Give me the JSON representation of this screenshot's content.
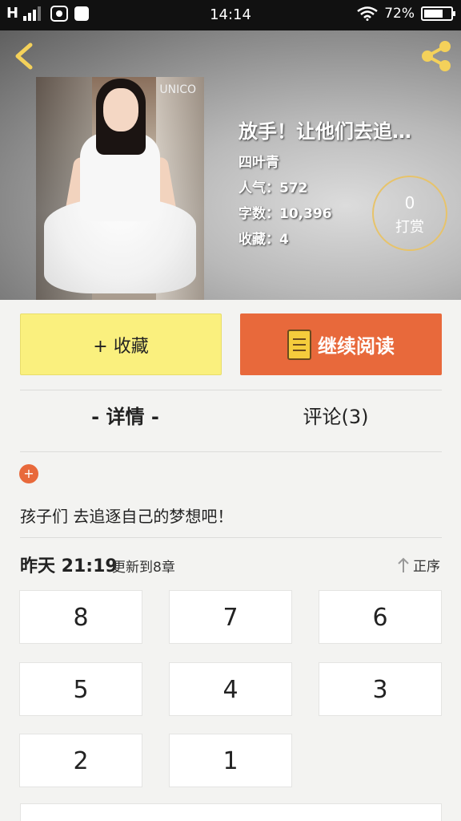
{
  "status_bar": {
    "network": "H",
    "time": "14:14",
    "battery_text": "72%",
    "battery_level": 0.72
  },
  "header": {
    "back_icon": "chevron-left-icon",
    "share_icon": "share-icon",
    "cover_sign_text": "UNICO",
    "title": "放手！让他们去追…",
    "author": "四叶青",
    "popularity": "人气：572",
    "word_count": "字数：10,396",
    "favorites": "收藏：4",
    "tip": {
      "count": "0",
      "label": "打赏"
    }
  },
  "actions": {
    "collect_label": "+ 收藏",
    "read_label": "继续阅读",
    "collect_color": "#faf07e",
    "read_color": "#e8693b"
  },
  "tabs": [
    {
      "label": "- 详情 -"
    },
    {
      "label": "评论(3)"
    }
  ],
  "detail": {
    "expand_icon": "plus-icon",
    "description": "孩子们 去追逐自己的梦想吧！"
  },
  "updates": {
    "time": "昨天 21:19",
    "text": "更新到8章",
    "sort_label": "正序",
    "sort_icon": "arrow-up-icon"
  },
  "chapters": [
    "8",
    "7",
    "6",
    "5",
    "4",
    "3",
    "2",
    "1"
  ]
}
